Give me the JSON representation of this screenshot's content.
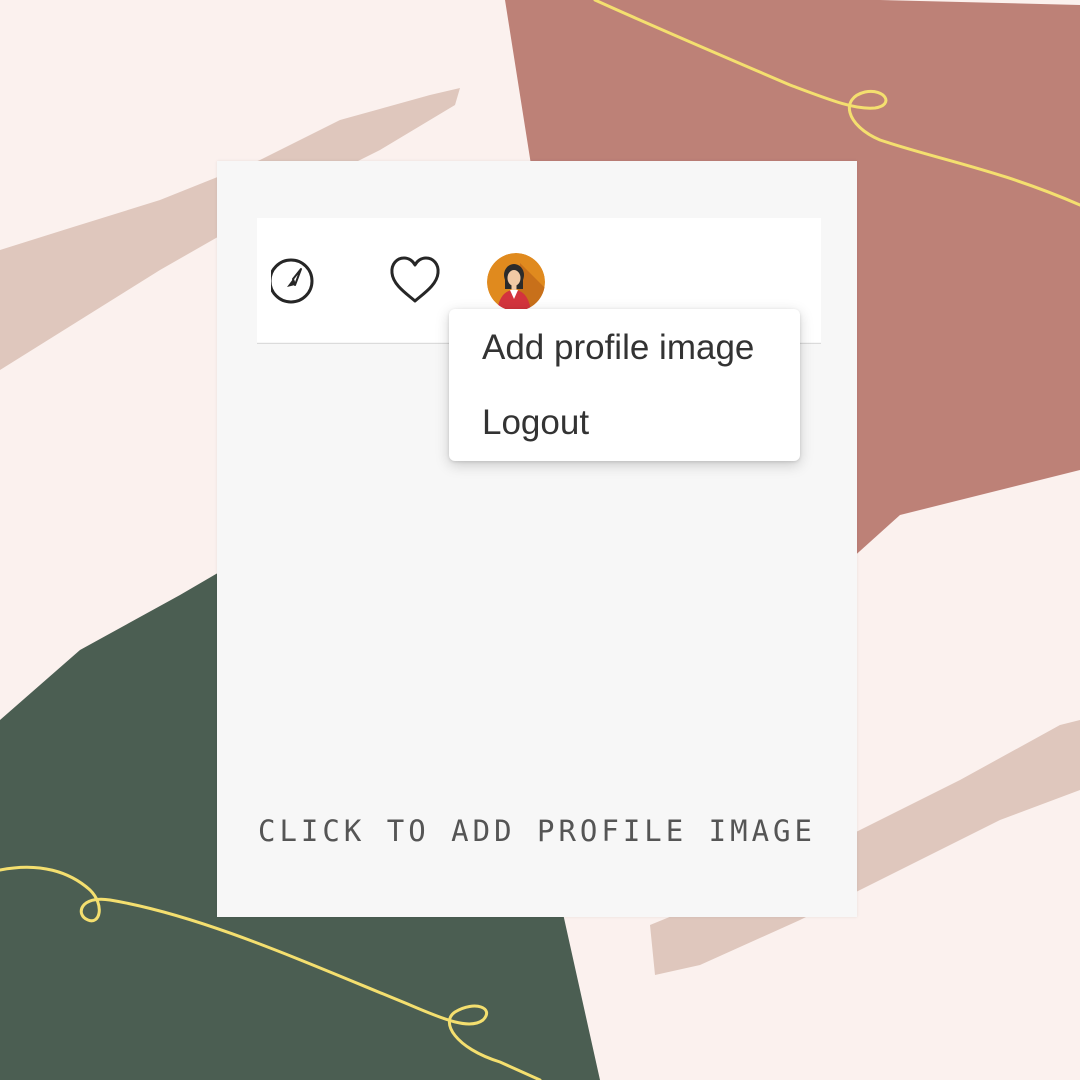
{
  "profile_menu": {
    "items": [
      {
        "label": "Add profile image"
      },
      {
        "label": "Logout"
      }
    ]
  },
  "caption": "CLICK TO ADD PROFILE IMAGE",
  "icons": {
    "compass": "compass-icon",
    "heart": "heart-icon",
    "avatar": "profile-avatar"
  },
  "colors": {
    "background": "#fbf1ee",
    "terracotta_shape": "#bd8177",
    "green_shape": "#4b5e52",
    "blush_brush": "#dfc7bd",
    "gold_line": "#f4df6f",
    "card": "#f7f7f7",
    "text": "#333333"
  }
}
